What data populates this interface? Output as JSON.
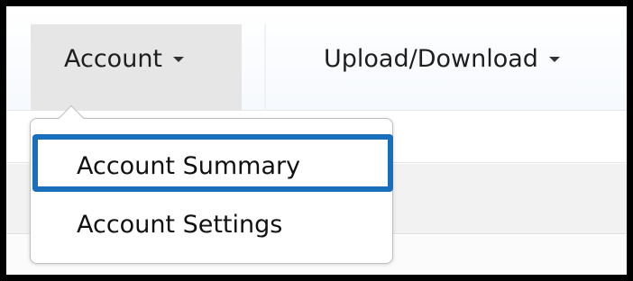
{
  "nav": {
    "account_label": "Account",
    "upload_label": "Upload/Download"
  },
  "dropdown": {
    "items": [
      {
        "label": "Account Summary",
        "highlighted": true
      },
      {
        "label": "Account Settings",
        "highlighted": false
      }
    ]
  },
  "colors": {
    "frame_border": "#000000",
    "highlight": "#1a6fbd",
    "active_nav_bg": "#e6e6e6",
    "navbar_bg": "#f6f9fd"
  },
  "icons": {
    "account_caret": "chevron-down-icon",
    "upload_caret": "chevron-down-icon"
  }
}
